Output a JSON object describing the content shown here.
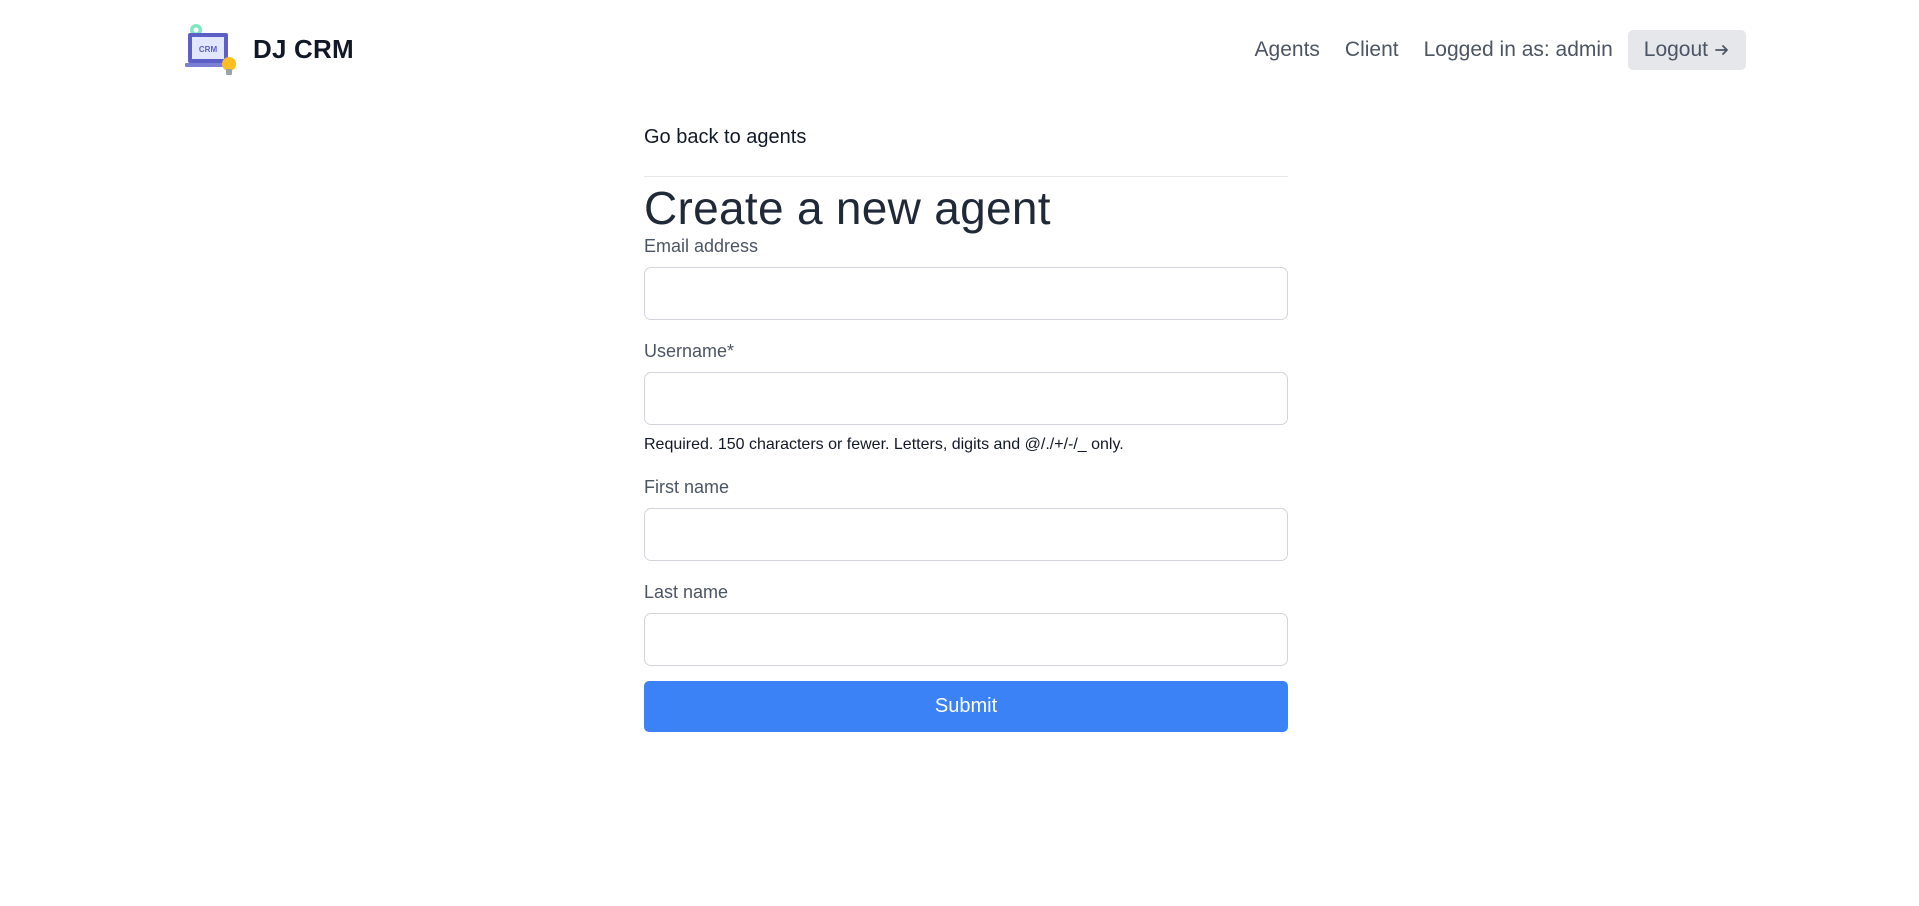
{
  "header": {
    "brand_name": "DJ CRM",
    "logo_text": "CRM",
    "nav": {
      "agents_label": "Agents",
      "client_label": "Client",
      "logged_in_text": "Logged in as: admin",
      "logout_label": "Logout"
    }
  },
  "main": {
    "back_link": "Go back to agents",
    "title": "Create a new agent",
    "fields": [
      {
        "label": "Email address",
        "value": "",
        "help": ""
      },
      {
        "label": "Username*",
        "value": "",
        "help": "Required. 150 characters or fewer. Letters, digits and @/./+/-/_ only."
      },
      {
        "label": "First name",
        "value": "",
        "help": ""
      },
      {
        "label": "Last name",
        "value": "",
        "help": ""
      }
    ],
    "submit_label": "Submit"
  },
  "colors": {
    "primary": "#3b82f6",
    "logout_bg": "#e5e7eb",
    "text_muted": "#4b5563"
  }
}
